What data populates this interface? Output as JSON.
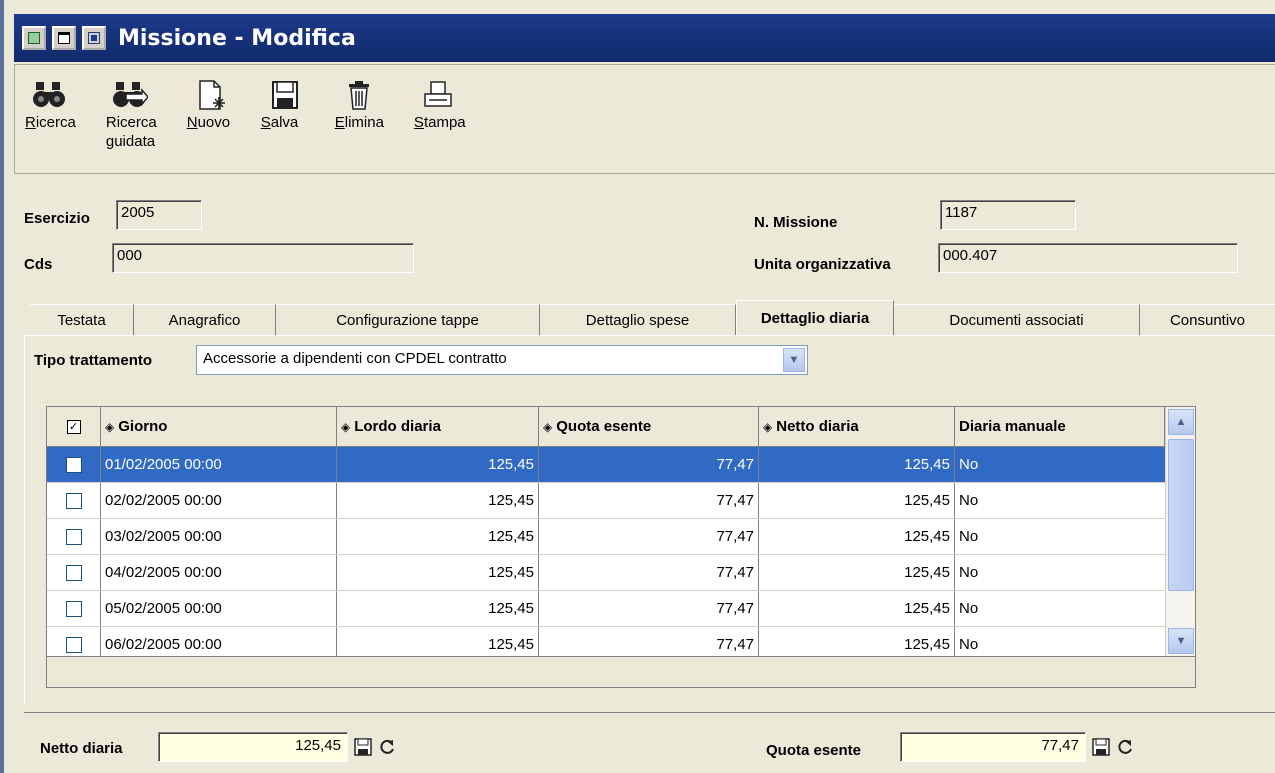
{
  "window": {
    "title": "Missione - Modifica"
  },
  "toolbar": {
    "items": [
      {
        "label_u": "R",
        "label_rest": "icerca",
        "icon": "binoculars-icon"
      },
      {
        "label_line1": "Ricerca",
        "label_u": "g",
        "label_rest": "uidata",
        "icon": "guided-search-icon"
      },
      {
        "label_u": "N",
        "label_rest": "uovo",
        "icon": "new-document-icon"
      },
      {
        "label_u": "S",
        "label_rest": "alva",
        "icon": "floppy-disk-icon"
      },
      {
        "label_u": "E",
        "label_rest": "limina",
        "icon": "trash-icon"
      },
      {
        "label_u": "S",
        "label_rest": "tampa",
        "icon": "printer-icon"
      }
    ]
  },
  "header": {
    "esercizio_label": "Esercizio",
    "esercizio_value": "2005",
    "cds_label": "Cds",
    "cds_value": "000",
    "n_missione_label": "N. Missione",
    "n_missione_value": "1187",
    "unita_label": "Unita organizzativa",
    "unita_value": "000.407"
  },
  "tabs": [
    {
      "label": "Testata"
    },
    {
      "label": "Anagrafico"
    },
    {
      "label": "Configurazione tappe"
    },
    {
      "label": "Dettaglio spese"
    },
    {
      "label": "Dettaglio diaria",
      "active": true
    },
    {
      "label": "Documenti associati"
    },
    {
      "label": "Consuntivo"
    }
  ],
  "tipo_trattamento": {
    "label": "Tipo trattamento",
    "value": "Accessorie a dipendenti con CPDEL contratto"
  },
  "grid": {
    "columns": [
      "Giorno",
      "Lordo diaria",
      "Quota esente",
      "Netto diaria",
      "Diaria manuale"
    ],
    "rows": [
      {
        "giorno": "01/02/2005 00:00",
        "lordo": "125,45",
        "quota": "77,47",
        "netto": "125,45",
        "manuale": "No",
        "selected": true
      },
      {
        "giorno": "02/02/2005 00:00",
        "lordo": "125,45",
        "quota": "77,47",
        "netto": "125,45",
        "manuale": "No"
      },
      {
        "giorno": "03/02/2005 00:00",
        "lordo": "125,45",
        "quota": "77,47",
        "netto": "125,45",
        "manuale": "No"
      },
      {
        "giorno": "04/02/2005 00:00",
        "lordo": "125,45",
        "quota": "77,47",
        "netto": "125,45",
        "manuale": "No"
      },
      {
        "giorno": "05/02/2005 00:00",
        "lordo": "125,45",
        "quota": "77,47",
        "netto": "125,45",
        "manuale": "No"
      },
      {
        "giorno": "06/02/2005 00:00",
        "lordo": "125,45",
        "quota": "77,47",
        "netto": "125,45",
        "manuale": "No"
      }
    ]
  },
  "footer": {
    "netto_label": "Netto diaria",
    "netto_value": "125,45",
    "quota_label": "Quota esente",
    "quota_value": "77,47"
  }
}
